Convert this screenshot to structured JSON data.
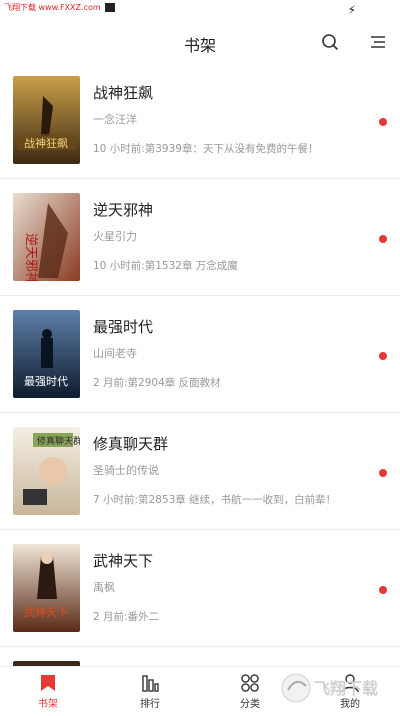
{
  "status": {
    "watermark_text": "飞翔下载 www.FXXZ.com"
  },
  "header": {
    "title": "书架"
  },
  "books": [
    {
      "title": "战神狂飙",
      "author": "一念汪洋",
      "update": "10 小时前:第3939章：天下从没有免费的午餐！",
      "cover_text": "战神狂飙"
    },
    {
      "title": "逆天邪神",
      "author": "火星引力",
      "update": "10 小时前:第1532章 万念成魔",
      "cover_text": "逆天邪神"
    },
    {
      "title": "最强时代",
      "author": "山间老寺",
      "update": "2 月前:第2904章 反面教材",
      "cover_text": "最强时代"
    },
    {
      "title": "修真聊天群",
      "author": "圣骑士的传说",
      "update": "7 小时前:第2853章 继续，书航一一收到，白前辈！",
      "cover_text": "修真聊天群"
    },
    {
      "title": "武神天下",
      "author": "禹枫",
      "update": "2 月前:番外二",
      "cover_text": "武神天下"
    }
  ],
  "tabs": [
    {
      "label": "书架",
      "icon": "bookmark-icon",
      "active": true
    },
    {
      "label": "排行",
      "icon": "bar-chart-icon",
      "active": false
    },
    {
      "label": "分类",
      "icon": "grid-circles-icon",
      "active": false
    },
    {
      "label": "我的",
      "icon": "person-icon",
      "active": false
    }
  ],
  "colors": {
    "accent": "#e53935",
    "text": "#222222",
    "muted": "#999999"
  },
  "site_watermark": "飞翔下载"
}
